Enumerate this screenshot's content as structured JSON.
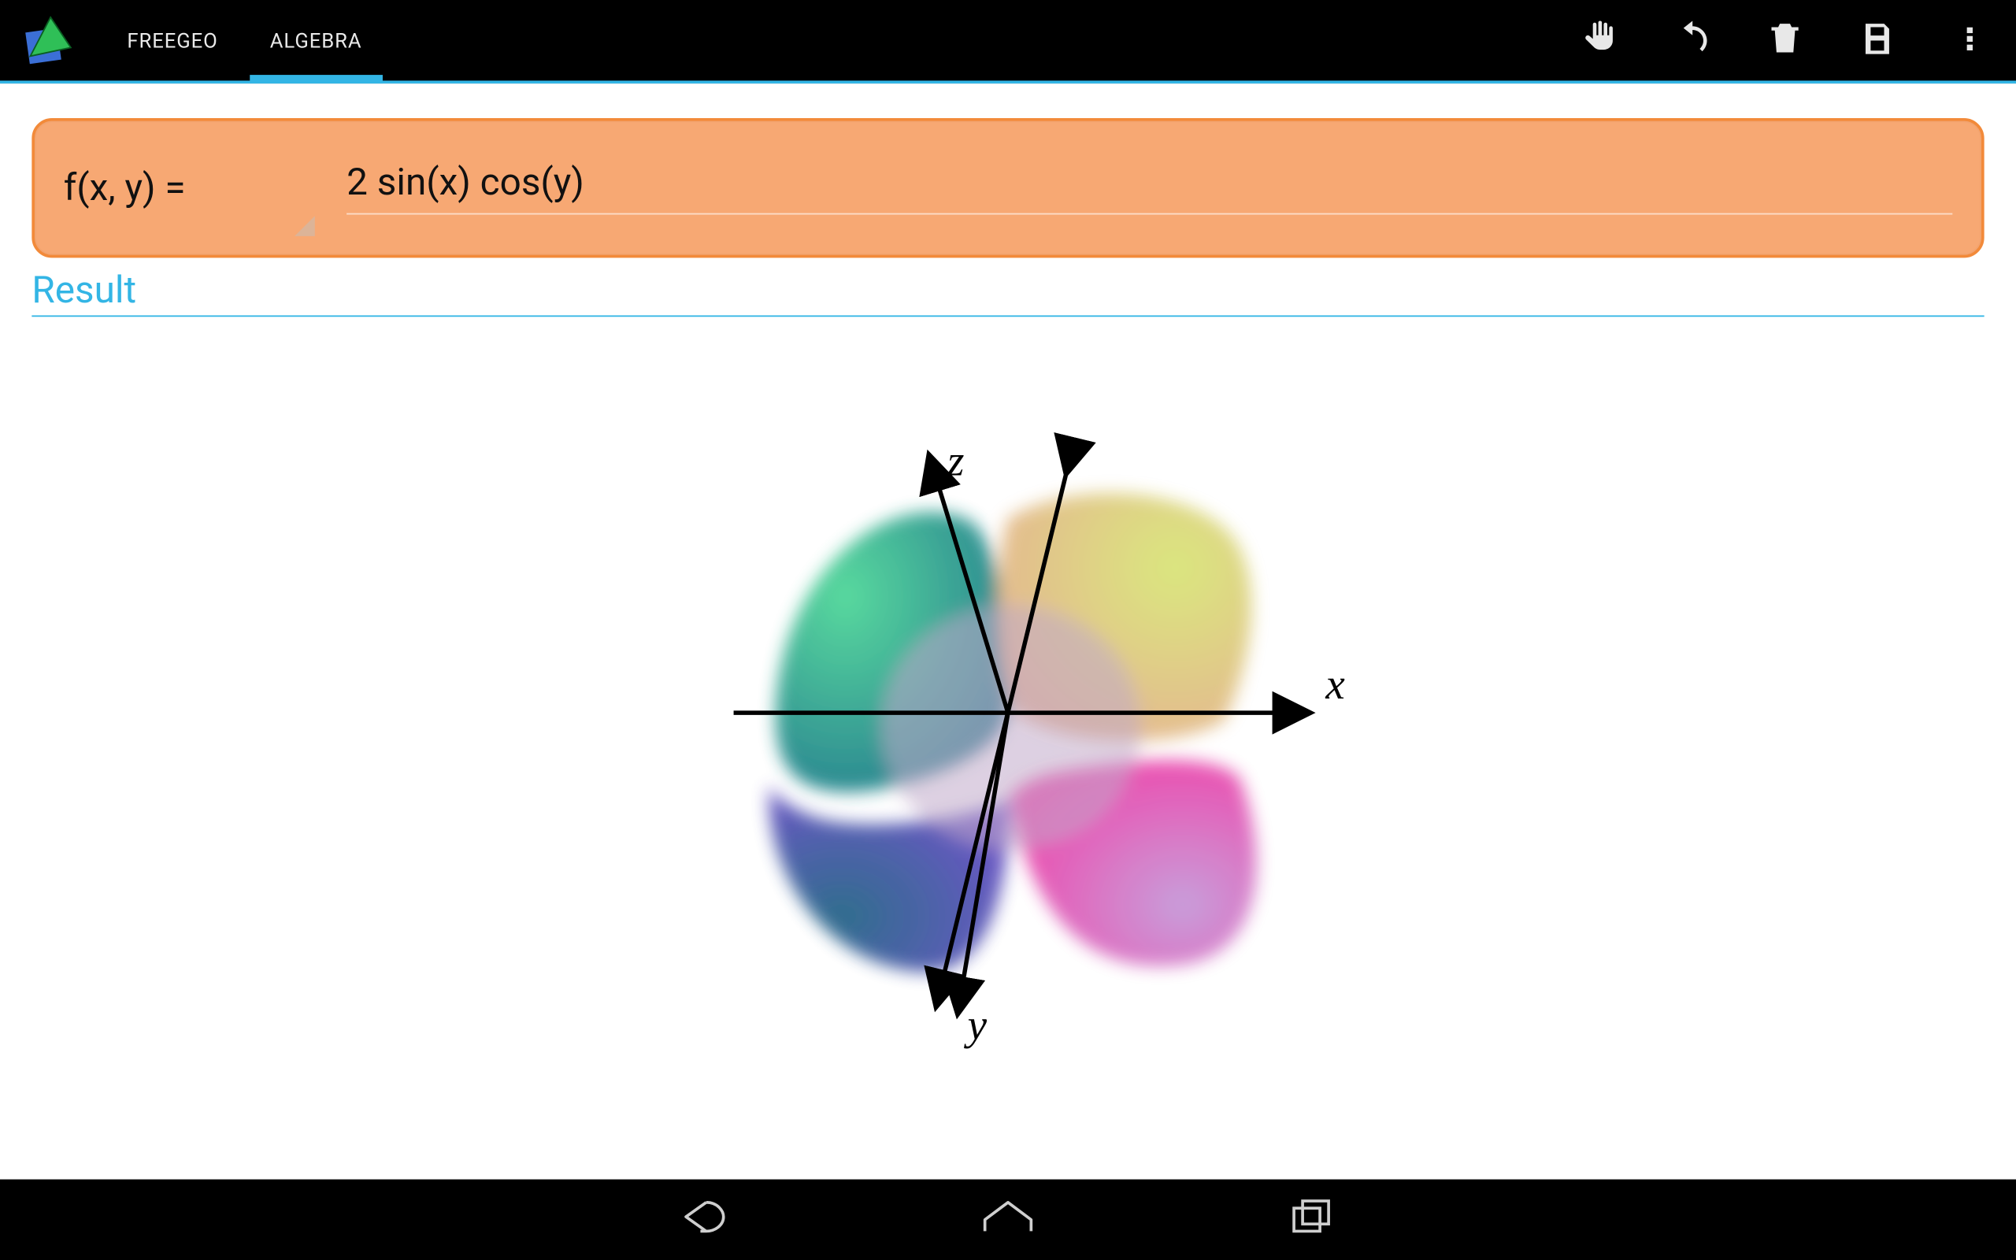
{
  "app": {
    "name": "FREEGEO",
    "tabs": [
      {
        "label": "FREEGEO",
        "active": false
      },
      {
        "label": "ALGEBRA",
        "active": true
      }
    ]
  },
  "toolbar": {
    "pan_icon": "hand-icon",
    "undo_icon": "undo-icon",
    "delete_icon": "trash-icon",
    "save_icon": "save-icon",
    "overflow_icon": "overflow-icon"
  },
  "formula": {
    "lhs": "f(x, y) =",
    "rhs": "2 sin(x) cos(y)"
  },
  "result": {
    "heading": "Result",
    "axes": {
      "x": "x",
      "y": "y",
      "z": "z"
    }
  },
  "navbar": {
    "back": "back-icon",
    "home": "home-icon",
    "recent": "recent-icon"
  },
  "chart_data": {
    "type": "surface3d",
    "function": "2*sin(x)*cos(y)",
    "axes": [
      "x",
      "y",
      "z"
    ],
    "z_range_estimate": [
      -2,
      2
    ],
    "title": "",
    "coloring": "hue-by-quadrant"
  }
}
